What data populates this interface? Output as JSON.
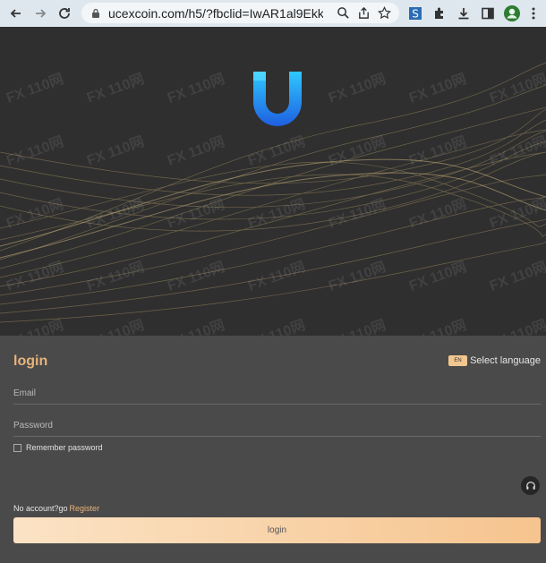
{
  "browser": {
    "url": "ucexcoin.com/h5/?fbclid=IwAR1al9EkkE...",
    "icons": [
      "back-icon",
      "forward-icon",
      "reload-icon",
      "lock-icon",
      "zoom-icon",
      "share-icon",
      "bookmark-star-icon",
      "s-extension-icon",
      "puzzle-extensions-icon",
      "download-icon",
      "sidepanel-icon",
      "profile-avatar-icon",
      "more-menu-icon"
    ]
  },
  "hero": {
    "logo_icon": "u-logo-icon",
    "colors": {
      "background": "#2f2f2f",
      "wave": "#8a7a55",
      "logo_top": "#2ec8ff",
      "logo_bottom": "#1f5fe0"
    }
  },
  "watermark": {
    "text": "FX 110网"
  },
  "form": {
    "title": "login",
    "language_flag": "EN",
    "language_label": "Select language",
    "email_placeholder": "Email",
    "password_placeholder": "Password",
    "remember_label": "Remember password",
    "no_account_text": "No account?go",
    "register_label": "Register",
    "login_button": "login",
    "colors": {
      "panel": "#4a4a4a",
      "accent": "#e8b37a",
      "button_from": "#fbe3c5",
      "button_to": "#f6c48e"
    }
  }
}
